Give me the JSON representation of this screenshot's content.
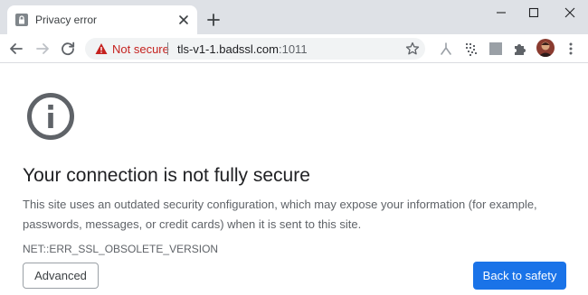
{
  "tab": {
    "title": "Privacy error"
  },
  "omnibox": {
    "security_label": "Not secure",
    "url_host": "tls-v1-1.badssl.com",
    "url_port": ":1011"
  },
  "icons": {
    "tab_favicon": "lock-page-icon",
    "tab_close": "close-icon",
    "new_tab": "plus-icon",
    "back": "arrow-left-icon",
    "forward": "arrow-right-icon",
    "reload": "reload-icon",
    "warning": "warning-triangle-icon",
    "bookmark": "star-icon",
    "extension_1": "branch-icon",
    "extension_2": "dots-grid-icon",
    "extension_3": "gray-square-icon",
    "extensions_menu": "puzzle-icon",
    "menu": "kebab-icon",
    "page": "info-circle-icon"
  },
  "colors": {
    "warning": "#c5221f",
    "primary_button": "#1a73e8",
    "tabstrip": "#dee1e6",
    "icon_gray": "#5f6368"
  },
  "content": {
    "heading": "Your connection is not fully secure",
    "description": "This site uses an outdated security configuration, which may expose your information (for example, passwords, messages, or credit cards) when it is sent to this site.",
    "error_code": "NET::ERR_SSL_OBSOLETE_VERSION",
    "advanced_button": "Advanced",
    "back_to_safety_button": "Back to safety"
  }
}
